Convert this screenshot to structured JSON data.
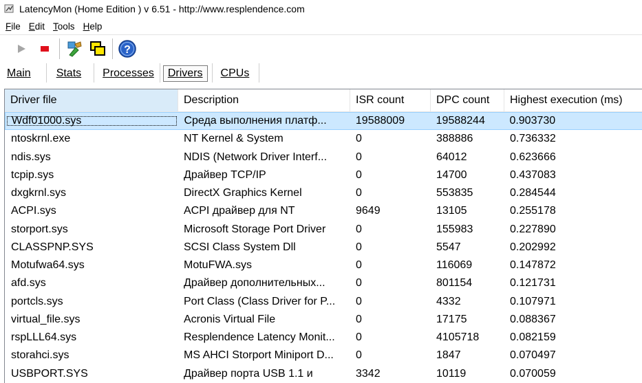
{
  "window": {
    "title": "LatencyMon  (Home Edition )  v 6.51 - http://www.resplendence.com"
  },
  "menu": {
    "items": [
      {
        "key": "F",
        "rest": "ile"
      },
      {
        "key": "E",
        "rest": "dit"
      },
      {
        "key": "T",
        "rest": "ools"
      },
      {
        "key": "H",
        "rest": "elp"
      }
    ]
  },
  "toolbar": {
    "buttons": [
      "play-icon",
      "stop-icon",
      "tools-icon",
      "windows-icon",
      "help-icon"
    ]
  },
  "tabs": [
    {
      "label": "Main"
    },
    {
      "label": "Stats"
    },
    {
      "label": "Processes"
    },
    {
      "label": "Drivers"
    },
    {
      "label": "CPUs"
    }
  ],
  "table": {
    "headers": [
      "Driver file",
      "Description",
      "ISR count",
      "DPC count",
      "Highest execution (ms)"
    ],
    "rows": [
      [
        "Wdf01000.sys",
        "Среда выполнения платф...",
        "19588009",
        "19588244",
        "0.903730"
      ],
      [
        "ntoskrnl.exe",
        "NT Kernel & System",
        "0",
        "388886",
        "0.736332"
      ],
      [
        "ndis.sys",
        "NDIS (Network Driver Interf...",
        "0",
        "64012",
        "0.623666"
      ],
      [
        "tcpip.sys",
        "Драйвер TCP/IP",
        "0",
        "14700",
        "0.437083"
      ],
      [
        "dxgkrnl.sys",
        "DirectX Graphics Kernel",
        "0",
        "553835",
        "0.284544"
      ],
      [
        "ACPI.sys",
        "ACPI драйвер для NT",
        "9649",
        "13105",
        "0.255178"
      ],
      [
        "storport.sys",
        "Microsoft Storage Port Driver",
        "0",
        "155983",
        "0.227890"
      ],
      [
        "CLASSPNP.SYS",
        "SCSI Class System Dll",
        "0",
        "5547",
        "0.202992"
      ],
      [
        "Motufwa64.sys",
        "MotuFWA.sys",
        "0",
        "116069",
        "0.147872"
      ],
      [
        "afd.sys",
        "Драйвер дополнительных...",
        "0",
        "801154",
        "0.121731"
      ],
      [
        "portcls.sys",
        "Port Class (Class Driver for P...",
        "0",
        "4332",
        "0.107971"
      ],
      [
        "virtual_file.sys",
        "Acronis Virtual File",
        "0",
        "17175",
        "0.088367"
      ],
      [
        "rspLLL64.sys",
        "Resplendence Latency Monit...",
        "0",
        "4105718",
        "0.082159"
      ],
      [
        "storahci.sys",
        "MS AHCI Storport Miniport D...",
        "0",
        "1847",
        "0.070497"
      ],
      [
        "USBPORT.SYS",
        "Драйвер порта USB 1.1 и",
        "3342",
        "10119",
        "0.070059"
      ]
    ],
    "selected_row": 0
  }
}
